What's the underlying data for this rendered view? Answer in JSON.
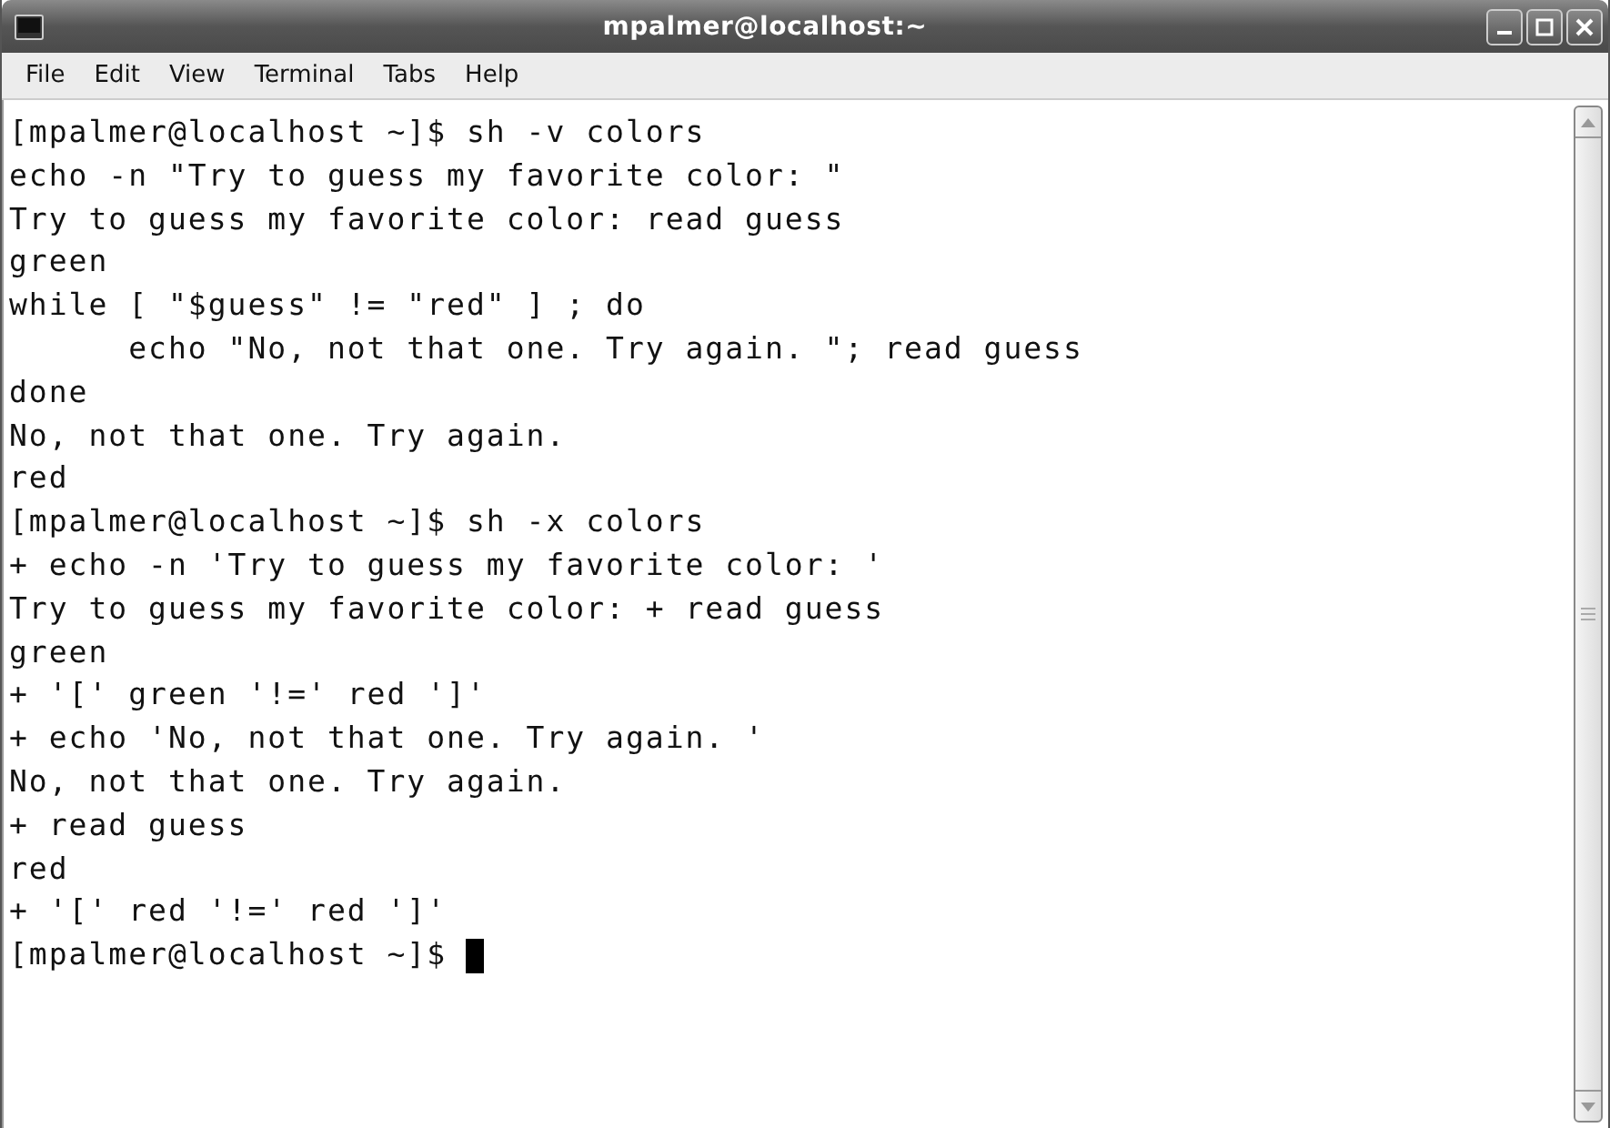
{
  "window": {
    "title": "mpalmer@localhost:~"
  },
  "menu": [
    "File",
    "Edit",
    "View",
    "Terminal",
    "Tabs",
    "Help"
  ],
  "terminal": {
    "lines": [
      "[mpalmer@localhost ~]$ sh -v colors",
      "echo -n \"Try to guess my favorite color: \"",
      "Try to guess my favorite color: read guess",
      "green",
      "while [ \"$guess\" != \"red\" ] ; do",
      "      echo \"No, not that one. Try again. \"; read guess",
      "done",
      "No, not that one. Try again.",
      "red",
      "[mpalmer@localhost ~]$ sh -x colors",
      "+ echo -n 'Try to guess my favorite color: '",
      "Try to guess my favorite color: + read guess",
      "green",
      "+ '[' green '!=' red ']'",
      "+ echo 'No, not that one. Try again. '",
      "No, not that one. Try again.",
      "+ read guess",
      "red",
      "+ '[' red '!=' red ']'",
      "[mpalmer@localhost ~]$ "
    ],
    "cursor": true
  }
}
